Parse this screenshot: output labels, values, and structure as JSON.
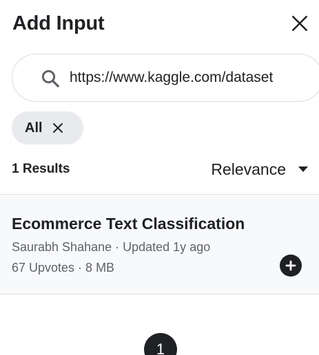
{
  "header": {
    "title": "Add Input"
  },
  "search": {
    "value": "https://www.kaggle.com/dataset",
    "icon": "search-icon"
  },
  "filters": {
    "chips": [
      {
        "label": "All"
      }
    ]
  },
  "results": {
    "count_label": "1 Results",
    "sort_label": "Relevance",
    "items": [
      {
        "title": "Ecommerce Text Classification",
        "meta": "Saurabh Shahane · Updated 1y ago",
        "stats": "67 Upvotes · 8 MB"
      }
    ]
  },
  "pagination": {
    "current_page": "1"
  },
  "colors": {
    "text_primary": "#202124",
    "text_secondary": "#5f6368",
    "chip_bg": "#e8eaed",
    "card_bg": "#f8f9fa",
    "border": "#dadce0"
  }
}
